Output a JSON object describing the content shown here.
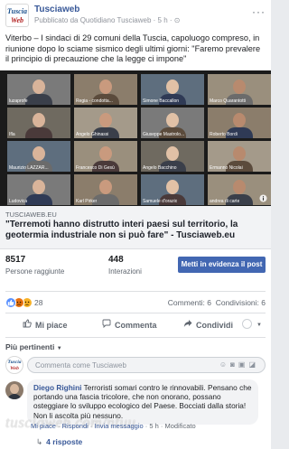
{
  "page": {
    "name": "Tusciaweb",
    "logo_line1": "Tuscia",
    "logo_line2": "Web",
    "meta": "Pubblicato da Quotidiano Tusciaweb · 5 h · ⊙",
    "menu_icon": "more-dots-icon",
    "post_text": "Viterbo – I sindaci di 29 comuni della Tuscia, capoluogo compreso, in riunione dopo lo sciame sismico degli ultimi giorni: \"Faremo prevalere il principio di precauzione che la legge ci impone\""
  },
  "photo": {
    "tiles": [
      {
        "name": "luzaprofe"
      },
      {
        "name": "Regia - condotta..."
      },
      {
        "name": "Simone Baccallon"
      },
      {
        "name": "Marco Quarantotti"
      },
      {
        "name": "Ifla"
      },
      {
        "name": "Angelo Ghinassi"
      },
      {
        "name": "Giuseppe Mastrolo..."
      },
      {
        "name": "Roberto Bordi"
      },
      {
        "name": "Maurizio LAZZAR..."
      },
      {
        "name": "Francesco Di Gesù"
      },
      {
        "name": "Angelo Bacchino"
      },
      {
        "name": "Ermanno Nicolai"
      },
      {
        "name": "Ludovica"
      },
      {
        "name": "Karl Pirker"
      },
      {
        "name": "Samuele d'orazio"
      },
      {
        "name": "andrea di carte"
      }
    ],
    "info_icon": "info-icon"
  },
  "link": {
    "domain": "TUSCIAWEB.EU",
    "title": "\"Terremoti hanno distrutto interi paesi sul territorio, la geotermia industriale non si può fare\" - Tusciaweb.eu"
  },
  "stats": {
    "reach_value": "8517",
    "reach_label": "Persone raggiunte",
    "interactions_value": "448",
    "interactions_label": "Interazioni",
    "boost_label": "Metti in evidenza il post"
  },
  "reactions": {
    "count": "28",
    "comments": "Commenti: 6",
    "shares": "Condivisioni: 6",
    "icons": [
      "like-icon",
      "angry-icon",
      "sad-icon"
    ]
  },
  "actions": {
    "like": "Mi piace",
    "comment": "Commenta",
    "share": "Condividi"
  },
  "comments": {
    "filter_label": "Più pertinenti",
    "composer_placeholder": "Commenta come Tusciaweb",
    "items": [
      {
        "author": "Diego Righini",
        "text": "Terroristi somari contro le rinnovabili. Pensano che portando una fascia tricolore, che non onorano, possano osteggiare lo sviluppo ecologico del Paese. Bocciati dalla storia! Non li ascolta più nessuno.",
        "actions": {
          "like": "Mi piace",
          "reply": "Rispondi",
          "message": "Invia messaggio",
          "time": "5 h",
          "edited": "Modificato"
        },
        "replies": "4 risposte"
      }
    ]
  },
  "watermark": "tusciaweb.com/ntuu"
}
